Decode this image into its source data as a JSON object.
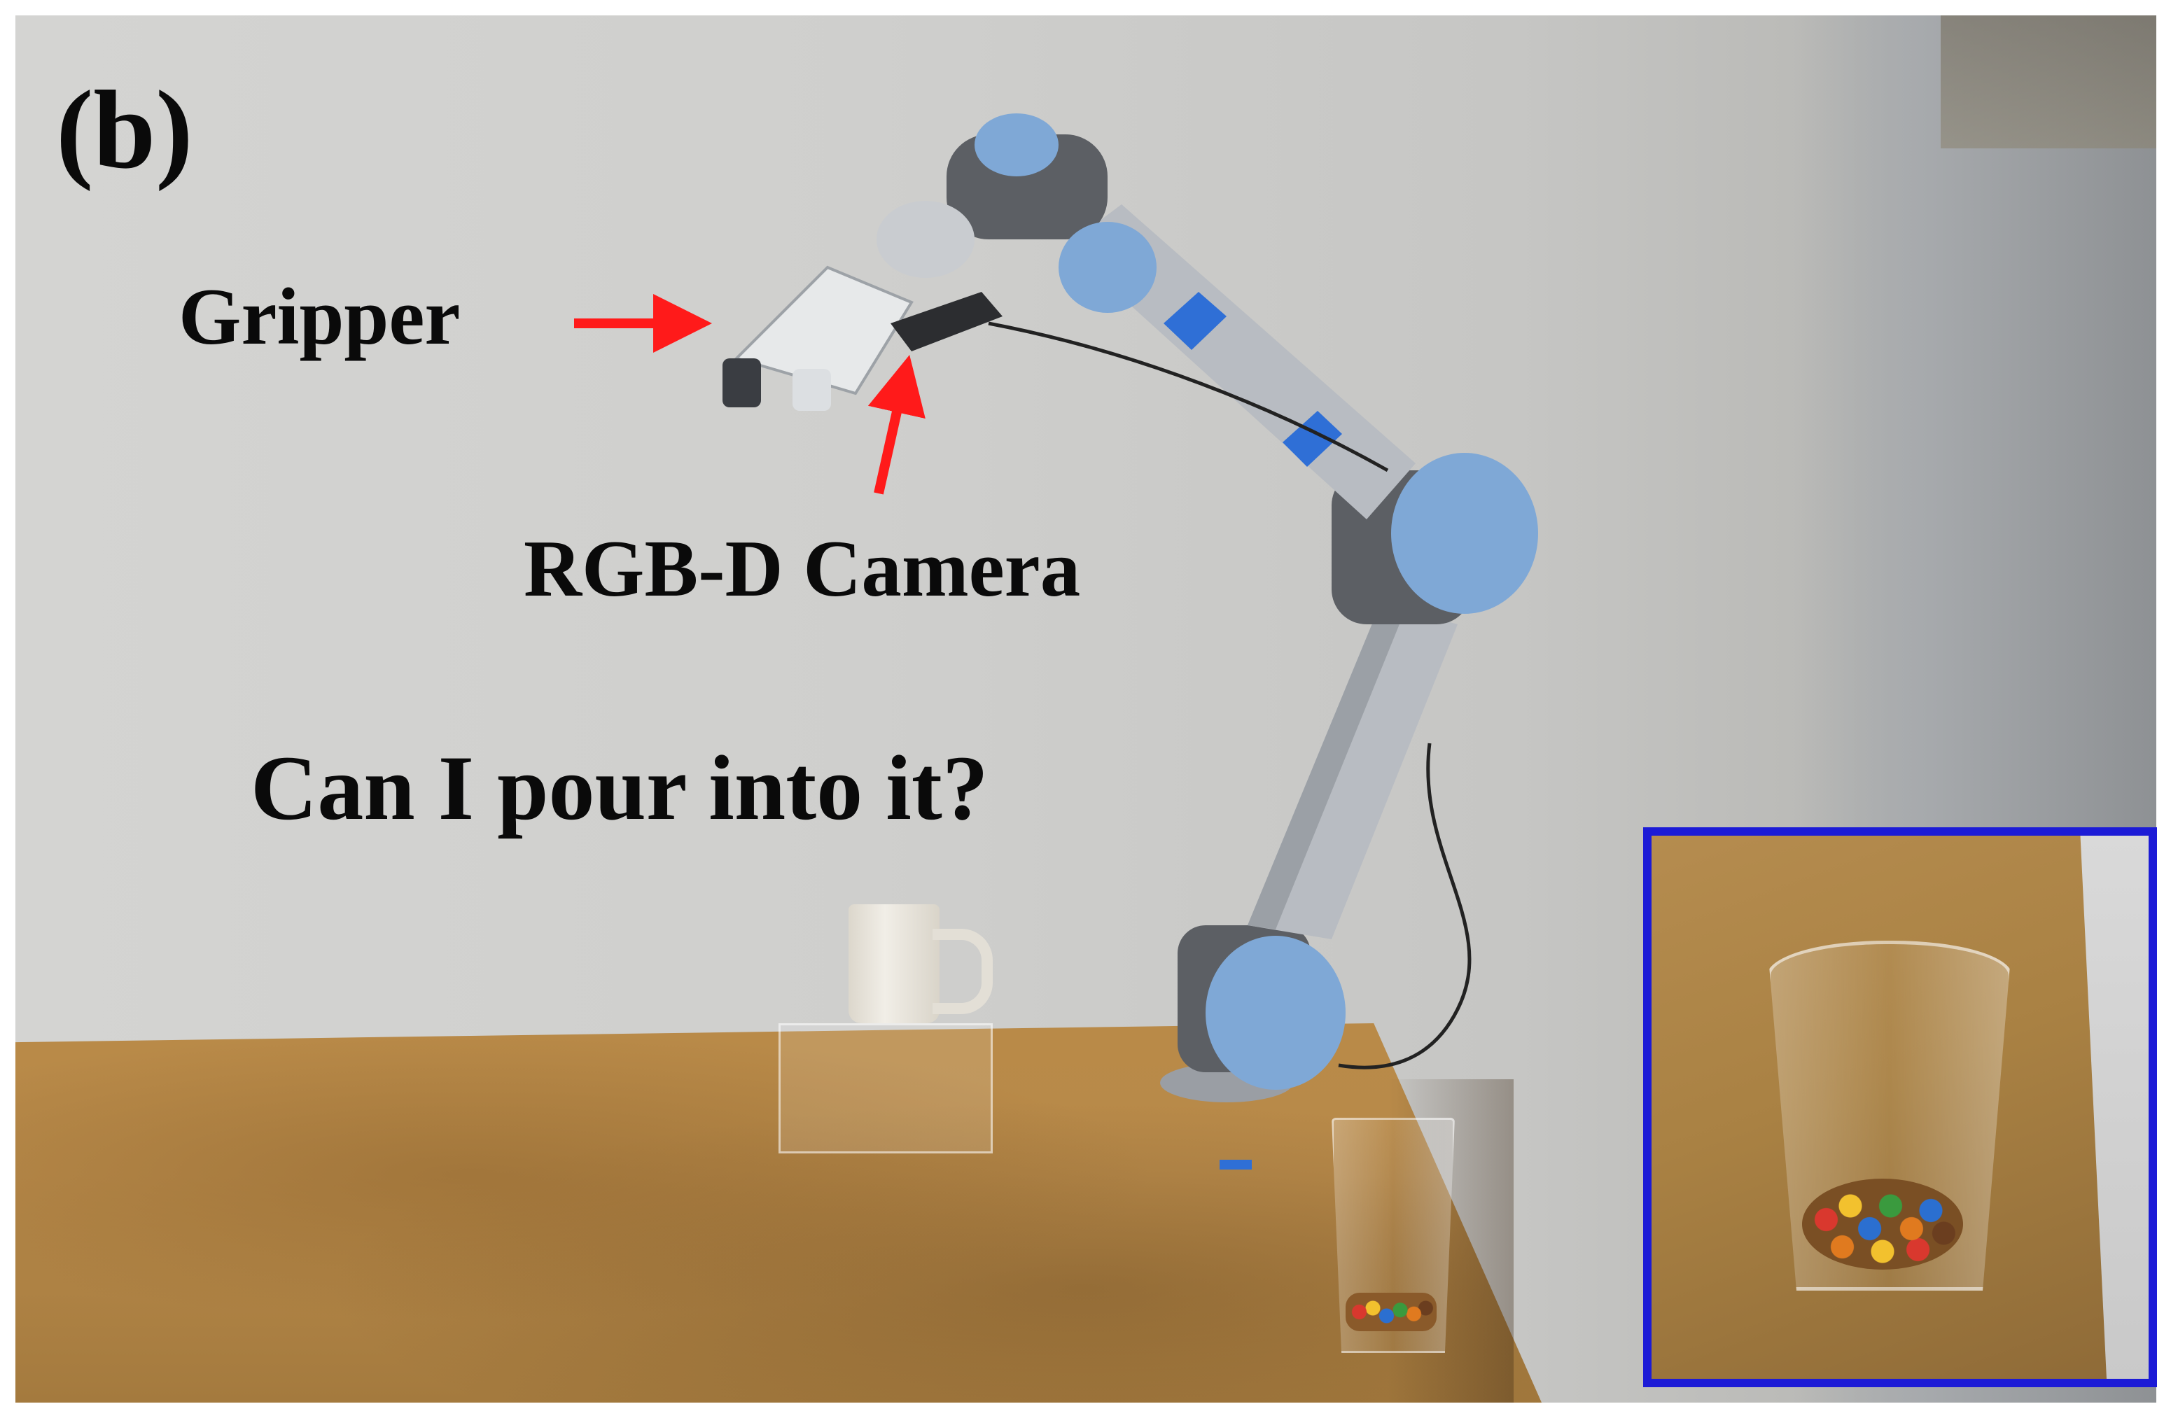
{
  "figure": {
    "panel_label": "(b)",
    "annotations": {
      "gripper": "Gripper",
      "camera": "RGB-D Camera",
      "question": "Can I pour into it?"
    },
    "colors": {
      "arrow": "#ff1a1a",
      "inset_border": "#1c1bd6",
      "robot_joint": "#7fa8d6",
      "robot_link": "#b8bcc2",
      "tape": "#2f6fd6"
    }
  }
}
